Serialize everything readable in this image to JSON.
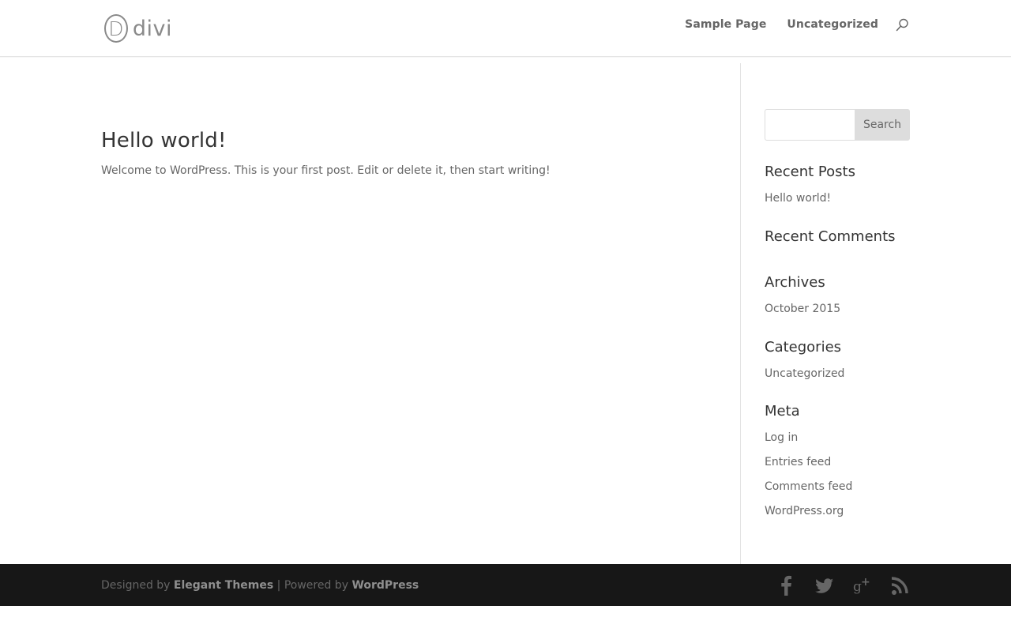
{
  "site": {
    "logo_text": "divi",
    "logo_mark": "D"
  },
  "nav": {
    "items": [
      "Sample Page",
      "Uncategorized"
    ],
    "search_icon": "search-icon"
  },
  "post": {
    "title": "Hello world!",
    "excerpt": "Welcome to WordPress. This is your first post. Edit or delete it, then start writing!"
  },
  "sidebar": {
    "search": {
      "value": "",
      "button_label": "Search"
    },
    "widgets": [
      {
        "title": "Recent Posts",
        "items": [
          "Hello world!"
        ]
      },
      {
        "title": "Recent Comments",
        "items": []
      },
      {
        "title": "Archives",
        "items": [
          "October 2015"
        ]
      },
      {
        "title": "Categories",
        "items": [
          "Uncategorized"
        ]
      },
      {
        "title": "Meta",
        "items": [
          "Log in",
          "Entries feed",
          "Comments feed",
          "WordPress.org"
        ]
      }
    ]
  },
  "footer": {
    "designed_by_prefix": "Designed by",
    "designer": "Elegant Themes",
    "separator": " | Powered by ",
    "platform": "WordPress",
    "social_icons": [
      "facebook-icon",
      "twitter-icon",
      "google-plus-icon",
      "rss-icon"
    ]
  },
  "colors": {
    "background": "#ffffff",
    "footer_background": "#171717",
    "text": "#666666",
    "heading": "#333333",
    "divider": "#e2e2e2",
    "search_button": "#dddddd",
    "icon": "#666666"
  }
}
